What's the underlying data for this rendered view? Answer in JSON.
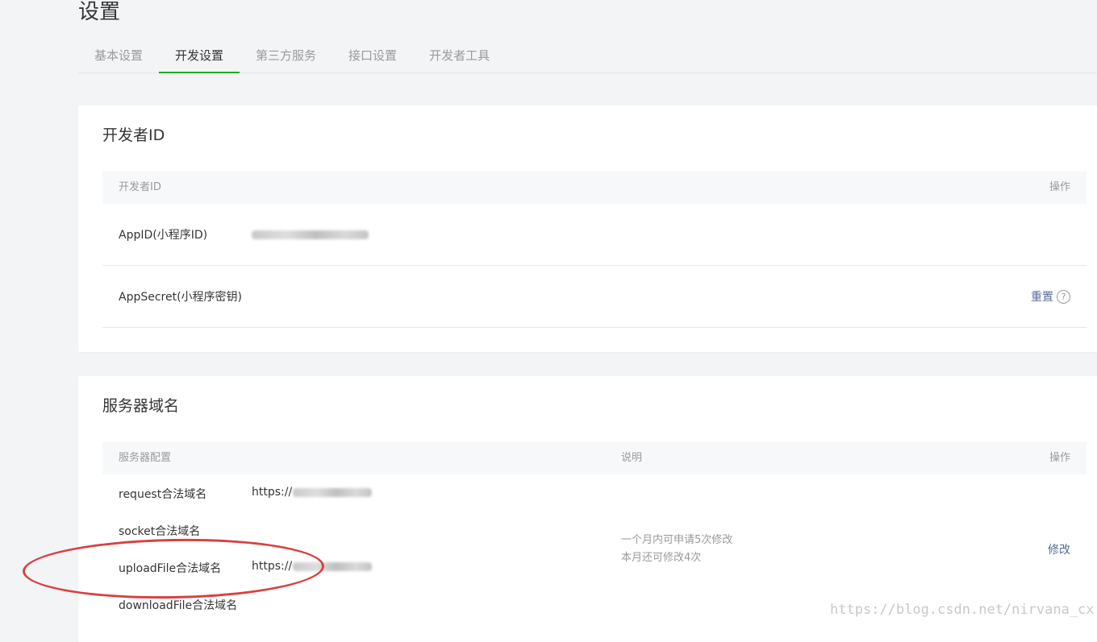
{
  "page": {
    "title": "设置"
  },
  "tabs": [
    {
      "label": "基本设置",
      "active": false
    },
    {
      "label": "开发设置",
      "active": true
    },
    {
      "label": "第三方服务",
      "active": false
    },
    {
      "label": "接口设置",
      "active": false
    },
    {
      "label": "开发者工具",
      "active": false
    }
  ],
  "developer": {
    "title": "开发者ID",
    "header": {
      "col1": "开发者ID",
      "action": "操作"
    },
    "rows": [
      {
        "label": "AppID(小程序ID)",
        "value_hidden": true
      },
      {
        "label": "AppSecret(小程序密钥)",
        "action": "重置",
        "help_icon": "?"
      }
    ]
  },
  "server": {
    "title": "服务器域名",
    "header": {
      "col1": "服务器配置",
      "col2": "说明",
      "action": "操作"
    },
    "rows": [
      {
        "label": "request合法域名",
        "value": "https://"
      },
      {
        "label": "socket合法域名",
        "value": ""
      },
      {
        "label": "uploadFile合法域名",
        "value": "https://"
      },
      {
        "label": "downloadFile合法域名",
        "value": ""
      }
    ],
    "desc_line1": "一个月内可申请5次修改",
    "desc_line2": "本月还可修改4次",
    "action": "修改"
  },
  "colors": {
    "accent": "#1aad19",
    "link": "#576b95",
    "annotation": "#d9403f"
  },
  "watermark": "https://blog.csdn.net/nirvana_cx"
}
